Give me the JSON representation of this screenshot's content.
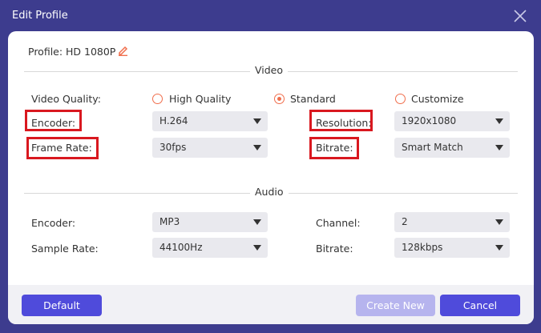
{
  "window": {
    "title": "Edit Profile"
  },
  "profile": {
    "label": "Profile:",
    "value": "HD 1080P"
  },
  "video": {
    "section_title": "Video",
    "quality_label": "Video Quality:",
    "quality_options": [
      {
        "label": "High Quality",
        "selected": false
      },
      {
        "label": "Standard",
        "selected": true
      },
      {
        "label": "Customize",
        "selected": false
      }
    ],
    "encoder_label": "Encoder:",
    "encoder_value": "H.264",
    "resolution_label": "Resolution:",
    "resolution_value": "1920x1080",
    "frame_rate_label": "Frame Rate:",
    "frame_rate_value": "30fps",
    "bitrate_label": "Bitrate:",
    "bitrate_value": "Smart Match"
  },
  "audio": {
    "section_title": "Audio",
    "encoder_label": "Encoder:",
    "encoder_value": "MP3",
    "channel_label": "Channel:",
    "channel_value": "2",
    "sample_rate_label": "Sample Rate:",
    "sample_rate_value": "44100Hz",
    "bitrate_label": "Bitrate:",
    "bitrate_value": "128kbps"
  },
  "buttons": {
    "default": "Default",
    "create_new": "Create New",
    "cancel": "Cancel"
  },
  "colors": {
    "accent": "#4f4bdb",
    "radio": "#f06e4c",
    "highlight": "#d9181f",
    "titlebar": "#3d3c8e",
    "disabled": "#b6b4ee"
  }
}
